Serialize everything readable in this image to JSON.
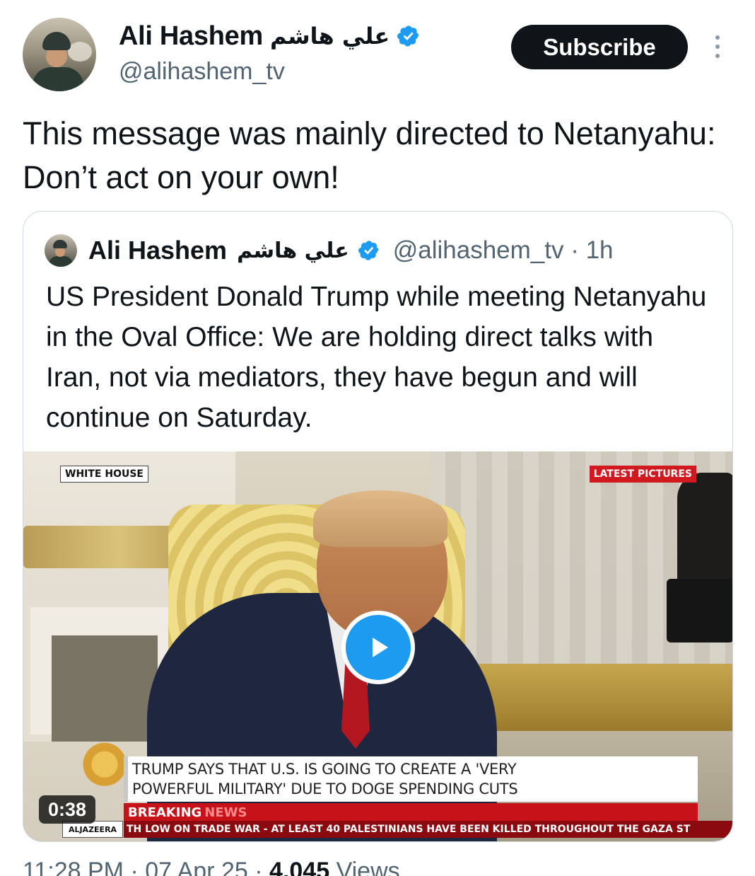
{
  "author": {
    "display_name": "Ali Hashem",
    "arabic_name": "علي هاشم",
    "handle": "@alihashem_tv"
  },
  "actions": {
    "subscribe_label": "Subscribe"
  },
  "tweet": {
    "text": "This message was mainly directed to Netanyahu: Don’t act on your own!"
  },
  "quoted_tweet": {
    "display_name": "Ali Hashem",
    "arabic_name": "علي هاشم",
    "handle_time": "@alihashem_tv · 1h",
    "text": "US President Donald Trump while meeting Netanyahu in the Oval Office: We are holding direct talks with Iran, not via mediators, they have begun and will continue on Saturday.",
    "video": {
      "duration": "0:38",
      "overlay_left_tag": "WHITE HOUSE",
      "overlay_right_tag": "LATEST PICTURES",
      "headline_line1": "TRUMP SAYS THAT U.S. IS GOING TO CREATE A 'VERY",
      "headline_line2": "POWERFUL MILITARY' DUE TO DOGE SPENDING CUTS",
      "breaking_label": "BREAKING",
      "breaking_suffix": "NEWS",
      "channel_strip": "ALJAZEERA",
      "ticker": "TH LOW ON TRADE WAR   -   AT LEAST 40 PALESTINIANS HAVE BEEN KILLED THROUGHOUT THE GAZA ST"
    }
  },
  "meta": {
    "time": "11:28 PM",
    "date": "07 Apr 25",
    "views_count": "4,045",
    "views_label": "Views"
  },
  "colors": {
    "accent": "#1d9bf0",
    "text": "#0f1419",
    "secondary": "#536471",
    "breaking_red": "#c7121a"
  },
  "icons": [
    "verified-badge-icon",
    "more-options-icon",
    "play-icon"
  ]
}
